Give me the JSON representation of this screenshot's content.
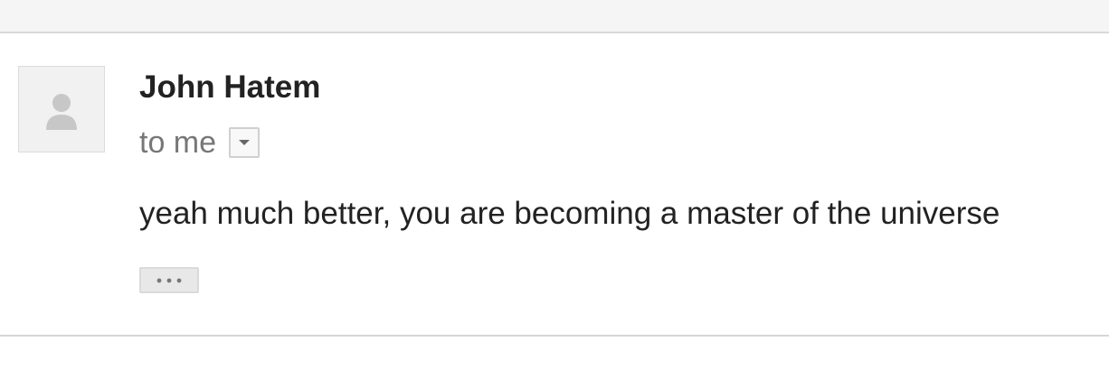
{
  "message": {
    "sender_name": "John Hatem",
    "recipients_label": "to me",
    "body": "yeah much better, you are becoming a master of the universe",
    "avatar_icon": "person-silhouette-icon",
    "details_icon": "chevron-down-icon",
    "trimmed_icon": "ellipsis-icon"
  },
  "colors": {
    "sender": "#222222",
    "recipients": "#777777",
    "avatar_background": "#f1f1f1",
    "avatar_figure": "#c7c7c7",
    "divider": "#d6d6d6"
  }
}
